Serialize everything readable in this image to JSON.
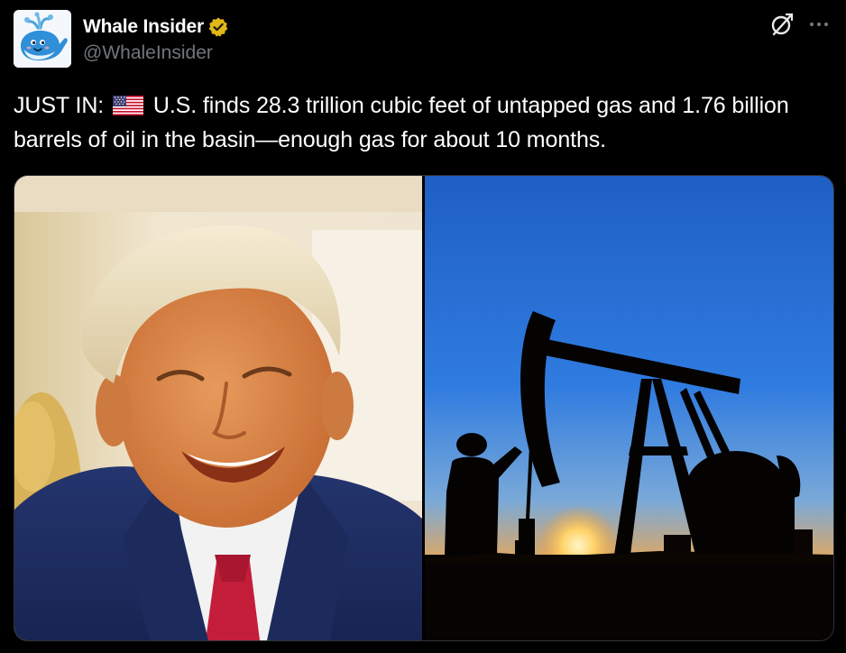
{
  "author": {
    "display_name": "Whale Insider",
    "handle": "@WhaleInsider",
    "verified": true,
    "avatar_icon": "whale-icon"
  },
  "header_actions": {
    "grok_icon": "grok-icon",
    "more_icon": "more-icon"
  },
  "post": {
    "prefix": "JUST IN:",
    "flag_icon": "us-flag-icon",
    "text": "U.S. finds 28.3 trillion cubic feet of untapped gas and 1.76 billion barrels of oil in the basin—enough gas for about 10 months."
  },
  "media": [
    {
      "kind": "photo",
      "subject": "portrait"
    },
    {
      "kind": "photo",
      "subject": "oil-pumpjack-sunset"
    }
  ],
  "colors": {
    "background": "#000000",
    "text_primary": "#ffffff",
    "text_secondary": "#71767b",
    "verified_gold": "#e2b719",
    "border": "#2f3336"
  }
}
